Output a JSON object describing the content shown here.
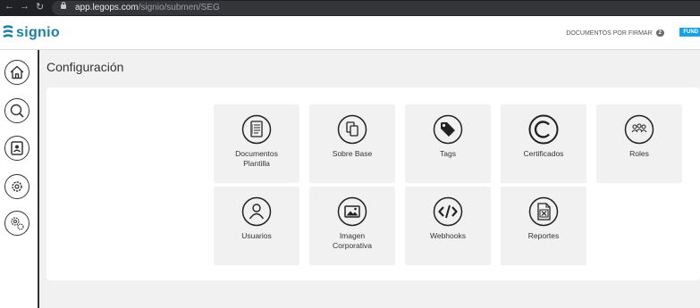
{
  "browser": {
    "url_host": "app.legops.com",
    "url_path": "/signio/submen/SEG"
  },
  "header": {
    "logo_text": "signio",
    "documents_label": "DOCUMENTOS POR FIRMAR",
    "documents_count": "2",
    "fund_label": "FUND"
  },
  "page": {
    "title": "Configuración"
  },
  "tiles": [
    {
      "label": "Documentos\nPlantilla",
      "icon": "document-list-icon"
    },
    {
      "label": "Sobre Base",
      "icon": "copy-documents-icon"
    },
    {
      "label": "Tags",
      "icon": "tag-icon"
    },
    {
      "label": "Certificados",
      "icon": "copyright-icon"
    },
    {
      "label": "Roles",
      "icon": "users-group-icon"
    },
    {
      "label": "Usuarios",
      "icon": "user-icon"
    },
    {
      "label": "Imagen\nCorporativa",
      "icon": "image-icon"
    },
    {
      "label": "Webhooks",
      "icon": "code-icon"
    },
    {
      "label": "Reportes",
      "icon": "excel-file-icon"
    }
  ],
  "sidebar": {
    "items": [
      "home-icon",
      "search-icon",
      "contacts-icon",
      "gear-icon",
      "settings-gears-icon"
    ]
  },
  "colors": {
    "brand": "#1b7fa8",
    "fund": "#19a3e6",
    "tile_bg": "#f1f1f2"
  }
}
